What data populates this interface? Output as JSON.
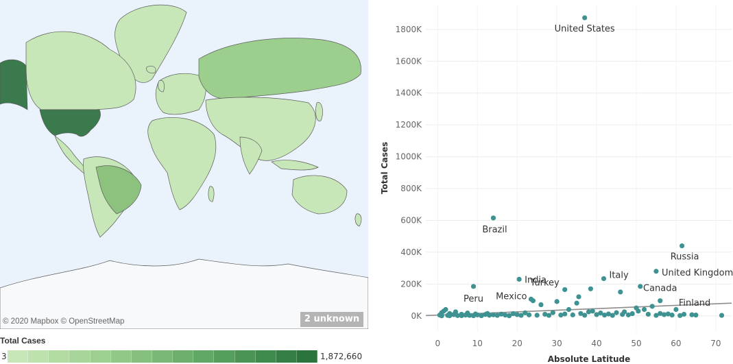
{
  "map": {
    "attribution": "© 2020 Mapbox © OpenStreetMap",
    "unknown_badge": "2 unknown",
    "legend": {
      "title": "Total Cases",
      "min": "3",
      "max": "1,872,660",
      "colors": [
        "#c7e7b8",
        "#bde2ad",
        "#b3dca3",
        "#a8d69a",
        "#9dcf91",
        "#91c888",
        "#85c07f",
        "#79b876",
        "#6db06d",
        "#61a765",
        "#569e5d",
        "#4a9455",
        "#3f8b4e",
        "#357f45",
        "#2c743d"
      ]
    },
    "country_colors": {
      "land_default": "#c7e7b8",
      "united_states": "#3a7a4c",
      "alaska": "#3a7a4c",
      "brazil": "#8cc27e",
      "russia": "#9ccf8e",
      "antarctica": "#f7f9fb",
      "greenland": "#c7e7b8",
      "water": "#eaf3fb"
    }
  },
  "chart_data": {
    "type": "scatter",
    "title": "",
    "xlabel": "Absolute Latitude",
    "ylabel": "Total Cases",
    "xlim": [
      -3,
      74
    ],
    "ylim": [
      -100000,
      1950000
    ],
    "xticks": [
      0,
      10,
      20,
      30,
      40,
      50,
      60,
      70
    ],
    "yticks": [
      0,
      200000,
      400000,
      600000,
      800000,
      1000000,
      1200000,
      1400000,
      1600000,
      1800000
    ],
    "ytick_labels": [
      "0K",
      "200K",
      "400K",
      "600K",
      "800K",
      "1000K",
      "1200K",
      "1400K",
      "1600K",
      "1800K"
    ],
    "grid": true,
    "trend_line": {
      "x": [
        -3,
        74
      ],
      "y": [
        2000,
        80000
      ]
    },
    "point_color": "#3f9292",
    "labeled_points": [
      {
        "name": "United States",
        "x": 37,
        "y": 1872660
      },
      {
        "name": "Brazil",
        "x": 14,
        "y": 615000
      },
      {
        "name": "Russia",
        "x": 61.5,
        "y": 440000
      },
      {
        "name": "United Kingdom",
        "x": 55,
        "y": 280000
      },
      {
        "name": "India",
        "x": 20.5,
        "y": 230000
      },
      {
        "name": "Turkey",
        "x": 32,
        "y": 165000
      },
      {
        "name": "Italy",
        "x": 41.8,
        "y": 234000
      },
      {
        "name": "Peru",
        "x": 9,
        "y": 185000
      },
      {
        "name": "Mexico",
        "x": 23.5,
        "y": 105000
      },
      {
        "name": "Canada",
        "x": 56,
        "y": 95000
      },
      {
        "name": "Finland",
        "x": 64,
        "y": 7000
      }
    ],
    "other_points": [
      [
        0.5,
        5000
      ],
      [
        1,
        20000
      ],
      [
        1.5,
        30000
      ],
      [
        2,
        40000
      ],
      [
        2.5,
        3000
      ],
      [
        3,
        15000
      ],
      [
        4,
        8000
      ],
      [
        4.5,
        25000
      ],
      [
        5,
        2000
      ],
      [
        6,
        10000
      ],
      [
        7,
        5000
      ],
      [
        7.5,
        18000
      ],
      [
        8,
        3000
      ],
      [
        9,
        1000
      ],
      [
        9.5,
        12000
      ],
      [
        10,
        6000
      ],
      [
        11,
        2000
      ],
      [
        12,
        9000
      ],
      [
        12.5,
        15000
      ],
      [
        13,
        4000
      ],
      [
        14,
        7000
      ],
      [
        15,
        3000
      ],
      [
        16,
        11000
      ],
      [
        17,
        5000
      ],
      [
        18,
        2000
      ],
      [
        19,
        14000
      ],
      [
        20,
        8000
      ],
      [
        21,
        3000
      ],
      [
        22,
        19000
      ],
      [
        23,
        6000
      ],
      [
        24,
        95000
      ],
      [
        25,
        4000
      ],
      [
        26,
        70000
      ],
      [
        27,
        10000
      ],
      [
        28,
        3000
      ],
      [
        29,
        20000
      ],
      [
        30,
        90000
      ],
      [
        31,
        5000
      ],
      [
        32,
        12000
      ],
      [
        33,
        40000
      ],
      [
        34,
        6000
      ],
      [
        35,
        80000
      ],
      [
        35.5,
        120000
      ],
      [
        36,
        15000
      ],
      [
        37,
        4000
      ],
      [
        38,
        25000
      ],
      [
        38.5,
        170000
      ],
      [
        39,
        30000
      ],
      [
        40,
        8000
      ],
      [
        41,
        18000
      ],
      [
        42,
        5000
      ],
      [
        43,
        12000
      ],
      [
        44,
        3000
      ],
      [
        45,
        20000
      ],
      [
        46,
        150000
      ],
      [
        46.5,
        9000
      ],
      [
        47,
        25000
      ],
      [
        48,
        6000
      ],
      [
        49,
        14000
      ],
      [
        50,
        50000
      ],
      [
        50.5,
        30000
      ],
      [
        51,
        185000
      ],
      [
        52,
        40000
      ],
      [
        53,
        10000
      ],
      [
        54,
        60000
      ],
      [
        55,
        3000
      ],
      [
        56,
        15000
      ],
      [
        57,
        8000
      ],
      [
        58,
        12000
      ],
      [
        59,
        5000
      ],
      [
        60,
        40000
      ],
      [
        61,
        2000
      ],
      [
        62,
        10000
      ],
      [
        65,
        5000
      ],
      [
        71.5,
        3000
      ],
      [
        1,
        500
      ],
      [
        3,
        800
      ],
      [
        6,
        1200
      ],
      [
        11,
        900
      ],
      [
        18,
        700
      ]
    ]
  }
}
